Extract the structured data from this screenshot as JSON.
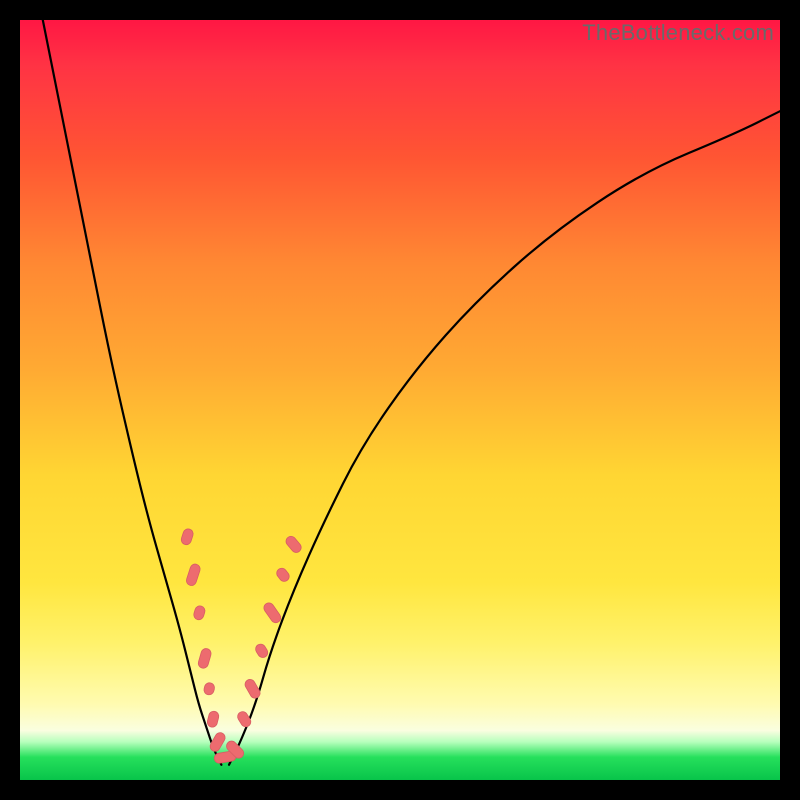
{
  "watermark": "TheBottleneck.com",
  "colors": {
    "marker_fill": "#ed6b6f",
    "marker_stroke": "#d85e63",
    "curve_stroke": "#000000"
  },
  "chart_data": {
    "type": "line",
    "title": "",
    "xlabel": "",
    "ylabel": "",
    "xlim": [
      0,
      100
    ],
    "ylim": [
      0,
      100
    ],
    "grid": false,
    "legend": false,
    "series": [
      {
        "name": "left-branch",
        "x": [
          3,
          6,
          9,
          12,
          15,
          17,
          19,
          21,
          22.5,
          23.5,
          24.5,
          25.5,
          26.5
        ],
        "y": [
          100,
          85,
          70,
          55,
          42,
          34,
          27,
          20,
          14,
          10,
          7,
          4,
          2
        ]
      },
      {
        "name": "right-branch",
        "x": [
          27.5,
          29,
          31,
          33,
          36,
          40,
          45,
          52,
          60,
          70,
          82,
          94,
          100
        ],
        "y": [
          2,
          5,
          10,
          17,
          25,
          34,
          44,
          54,
          63,
          72,
          80,
          85,
          88
        ]
      }
    ],
    "markers": {
      "name": "highlight-segments",
      "note": "pink pill markers clustered near the valley bottom on both branches",
      "points": [
        {
          "x": 22.0,
          "y": 32,
          "angle_deg": -72,
          "len": 16
        },
        {
          "x": 22.8,
          "y": 27,
          "angle_deg": -72,
          "len": 22
        },
        {
          "x": 23.6,
          "y": 22,
          "angle_deg": -73,
          "len": 14
        },
        {
          "x": 24.3,
          "y": 16,
          "angle_deg": -74,
          "len": 20
        },
        {
          "x": 24.9,
          "y": 12,
          "angle_deg": -75,
          "len": 12
        },
        {
          "x": 25.4,
          "y": 8,
          "angle_deg": -76,
          "len": 16
        },
        {
          "x": 26.0,
          "y": 5,
          "angle_deg": -60,
          "len": 20
        },
        {
          "x": 27.0,
          "y": 3,
          "angle_deg": -10,
          "len": 22
        },
        {
          "x": 28.3,
          "y": 4,
          "angle_deg": 45,
          "len": 20
        },
        {
          "x": 29.5,
          "y": 8,
          "angle_deg": 58,
          "len": 16
        },
        {
          "x": 30.6,
          "y": 12,
          "angle_deg": 60,
          "len": 20
        },
        {
          "x": 31.8,
          "y": 17,
          "angle_deg": 58,
          "len": 14
        },
        {
          "x": 33.2,
          "y": 22,
          "angle_deg": 55,
          "len": 22
        },
        {
          "x": 34.6,
          "y": 27,
          "angle_deg": 52,
          "len": 14
        },
        {
          "x": 36.0,
          "y": 31,
          "angle_deg": 50,
          "len": 18
        }
      ]
    }
  }
}
